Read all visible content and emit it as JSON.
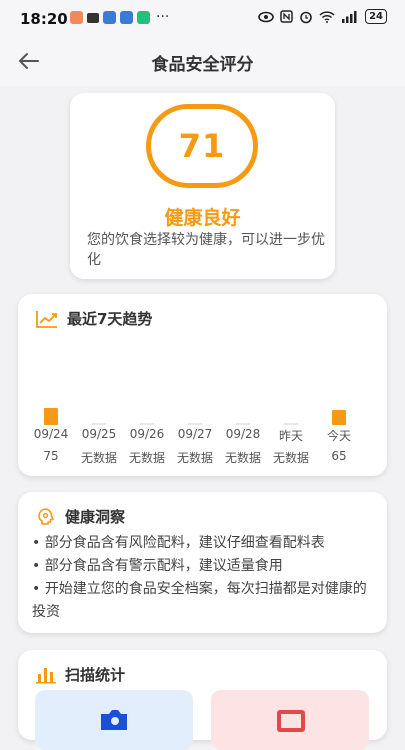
{
  "status_bar": {
    "time": "18:20",
    "more": "···",
    "battery": "24"
  },
  "header": {
    "title": "食品安全评分"
  },
  "score": {
    "value": "71",
    "status": "健康良好",
    "description": "您的饮食选择较为健康，可以进一步优化"
  },
  "trend": {
    "title": "最近7天趋势",
    "days": [
      {
        "date": "09/24",
        "value": "75",
        "score": 75
      },
      {
        "date": "09/25",
        "value": "无数据",
        "score": null
      },
      {
        "date": "09/26",
        "value": "无数据",
        "score": null
      },
      {
        "date": "09/27",
        "value": "无数据",
        "score": null
      },
      {
        "date": "09/28",
        "value": "无数据",
        "score": null
      },
      {
        "date": "昨天",
        "value": "无数据",
        "score": null
      },
      {
        "date": "今天",
        "value": "65",
        "score": 65
      }
    ]
  },
  "insights": {
    "title": "健康洞察",
    "items": [
      "• 部分食品含有风险配料，建议仔细查看配料表",
      "• 部分食品含有警示配料，建议适量食用",
      "• 开始建立您的食品安全档案，每次扫描都是对健康的投资"
    ]
  },
  "scan_stats": {
    "title": "扫描统计"
  },
  "colors": {
    "accent": "#f59a12",
    "background": "#f2f2f4"
  }
}
